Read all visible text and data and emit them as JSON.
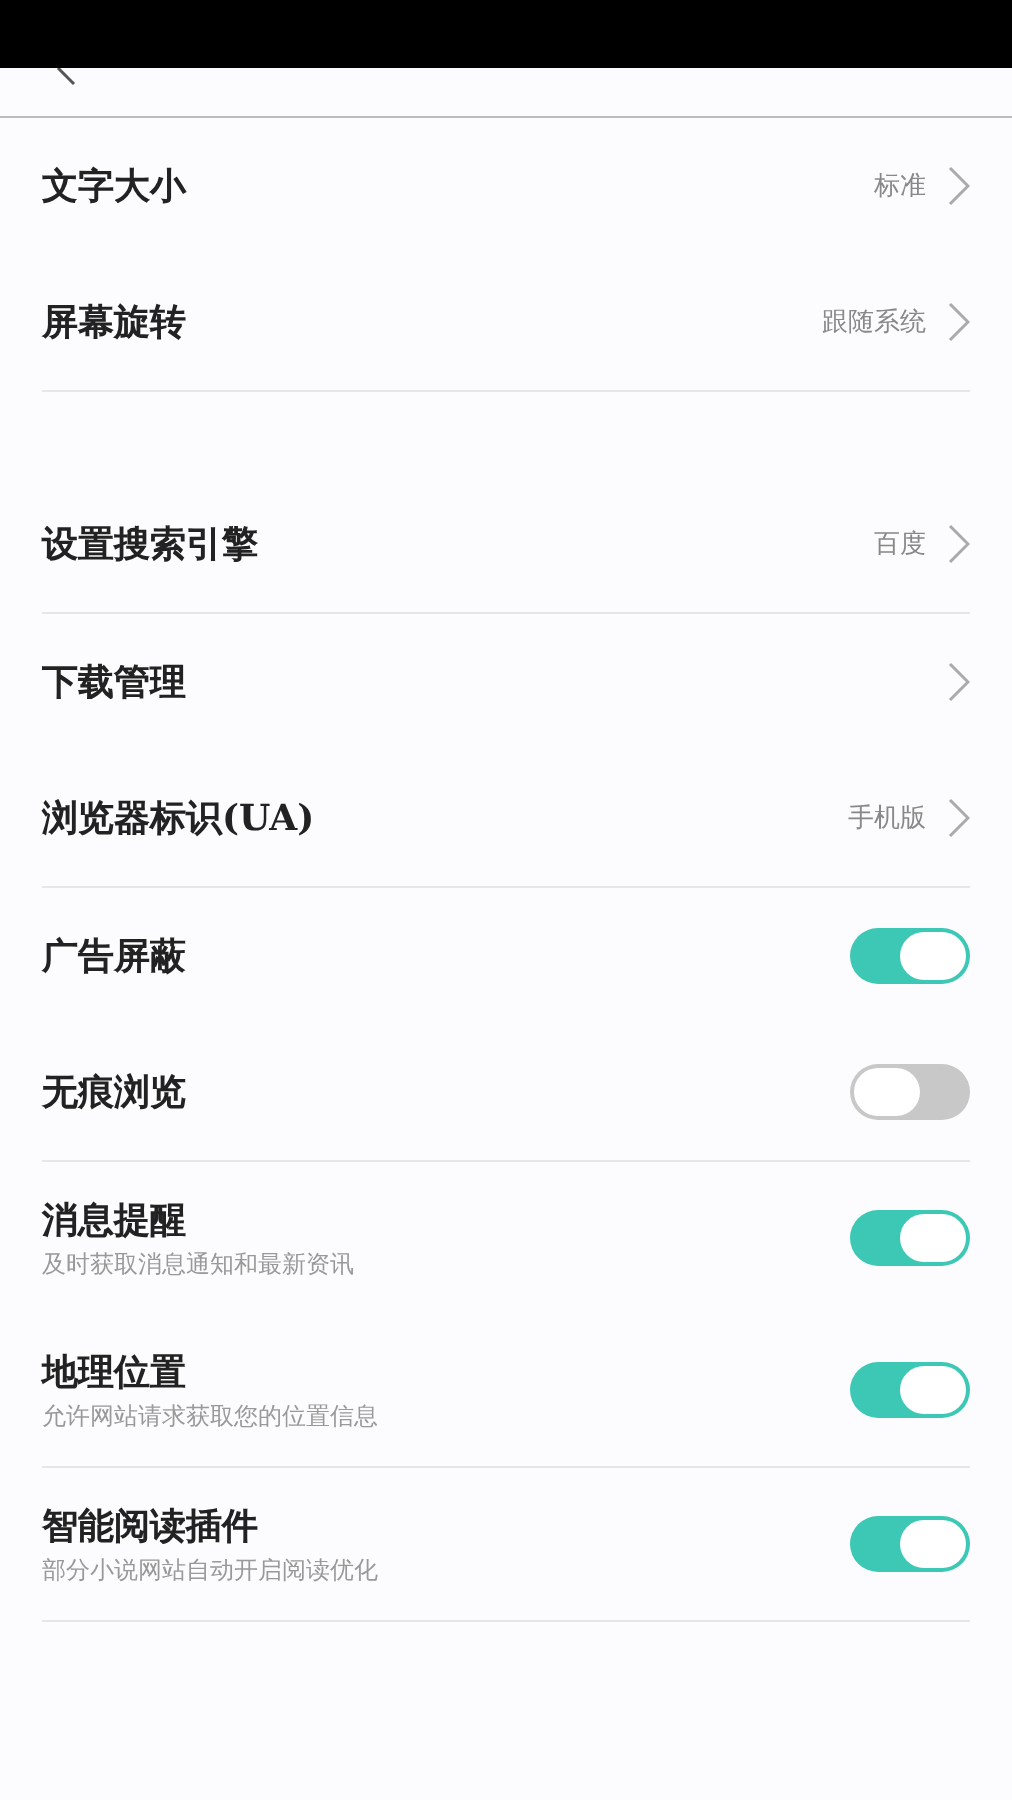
{
  "groups": [
    {
      "items": [
        {
          "kind": "link",
          "label": "文字大小",
          "value": "标准"
        },
        {
          "kind": "link",
          "label": "屏幕旋转",
          "value": "跟随系统"
        }
      ]
    },
    {
      "items": [
        {
          "kind": "link",
          "label": "设置搜索引擎",
          "value": "百度"
        }
      ]
    },
    {
      "items": [
        {
          "kind": "link",
          "label": "下载管理"
        },
        {
          "kind": "link",
          "label": "浏览器标识(UA)",
          "value": "手机版"
        }
      ]
    },
    {
      "items": [
        {
          "kind": "toggle",
          "label": "广告屏蔽",
          "on": true
        },
        {
          "kind": "toggle",
          "label": "无痕浏览",
          "on": false
        }
      ]
    },
    {
      "items": [
        {
          "kind": "toggle",
          "label": "消息提醒",
          "subtitle": "及时获取消息通知和最新资讯",
          "on": true
        },
        {
          "kind": "toggle",
          "label": "地理位置",
          "subtitle": "允许网站请求获取您的位置信息",
          "on": true
        }
      ]
    },
    {
      "items": [
        {
          "kind": "toggle",
          "label": "智能阅读插件",
          "subtitle": "部分小说网站自动开启阅读优化",
          "on": true
        }
      ]
    }
  ]
}
